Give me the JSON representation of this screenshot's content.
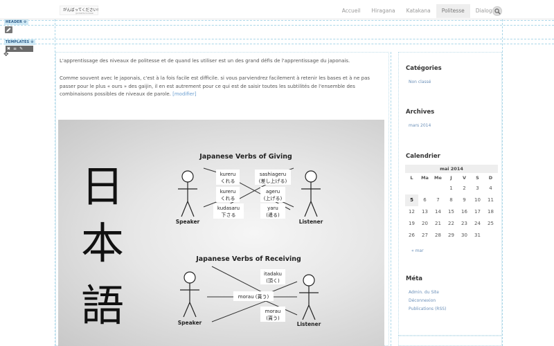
{
  "site": {
    "logo_text": "がんばってください!",
    "logo_sub": "ganbatte kudasai"
  },
  "nav": {
    "items": [
      {
        "label": "Accueil",
        "active": false
      },
      {
        "label": "Hiragana",
        "active": false
      },
      {
        "label": "Katakana",
        "active": false
      },
      {
        "label": "Politesse",
        "active": true
      },
      {
        "label": "Dialogue",
        "active": false
      }
    ]
  },
  "builder": {
    "header_tag": "HEADER ⚙",
    "templates_tag": "TEMPLATES ⚙"
  },
  "article": {
    "para1": "L'apprentissage des niveaux de politesse et de quand les utiliser est un des grand défis de l'apprentissage du japonais.",
    "para2": "Comme souvent avec le japonais, c'est à la fois facile est difficile. si vous parviendrez facilement à retenir les bases et à ne pas passer pour le plus « ours » des gaijin, il en est autrement pour ce qui est de saisir toutes les subtilités de l'ensemble des combinaisons possibles de niveaux de parole.",
    "more_link": "[modifier]"
  },
  "figure": {
    "kanji": [
      "日",
      "本",
      "語"
    ],
    "giving": {
      "title": "Japanese Verbs of Giving",
      "speaker": "Speaker",
      "listener": "Listener",
      "left_labels": [
        [
          "kureru",
          "くれる"
        ],
        [
          "kureru",
          "くれる"
        ],
        [
          "kudasaru",
          "下さる"
        ]
      ],
      "right_labels": [
        [
          "sashiageru",
          "(差し上げる)"
        ],
        [
          "ageru",
          "(上げる)"
        ],
        [
          "yaru",
          "(遣る)"
        ]
      ]
    },
    "receiving": {
      "title": "Japanese Verbs of Receiving",
      "speaker": "Speaker",
      "listener": "Listener",
      "center": "morau (貰う)",
      "top_right": [
        "itadaku",
        "(頂く)"
      ],
      "bottom_right": [
        "morau",
        "(貰う)"
      ]
    }
  },
  "sidebar": {
    "categories_title": "Catégories",
    "categories": [
      "Non classé"
    ],
    "archives_title": "Archives",
    "archives": [
      "mars 2014"
    ],
    "calendar_title": "Calendrier",
    "calendar": {
      "month": "mai 2014",
      "dow": [
        "L",
        "Ma",
        "Me",
        "J",
        "V",
        "S",
        "D"
      ],
      "weeks": [
        [
          "",
          "",
          "",
          "1",
          "2",
          "3",
          "4"
        ],
        [
          "5",
          "6",
          "7",
          "8",
          "9",
          "10",
          "11"
        ],
        [
          "12",
          "13",
          "14",
          "15",
          "16",
          "17",
          "18"
        ],
        [
          "19",
          "20",
          "21",
          "22",
          "23",
          "24",
          "25"
        ],
        [
          "26",
          "27",
          "28",
          "29",
          "30",
          "31",
          ""
        ]
      ],
      "today": "5",
      "prev": "« mar"
    },
    "meta_title": "Méta",
    "meta": [
      "Admin. du Site",
      "Déconnexion",
      "Publications (RSS)"
    ]
  }
}
